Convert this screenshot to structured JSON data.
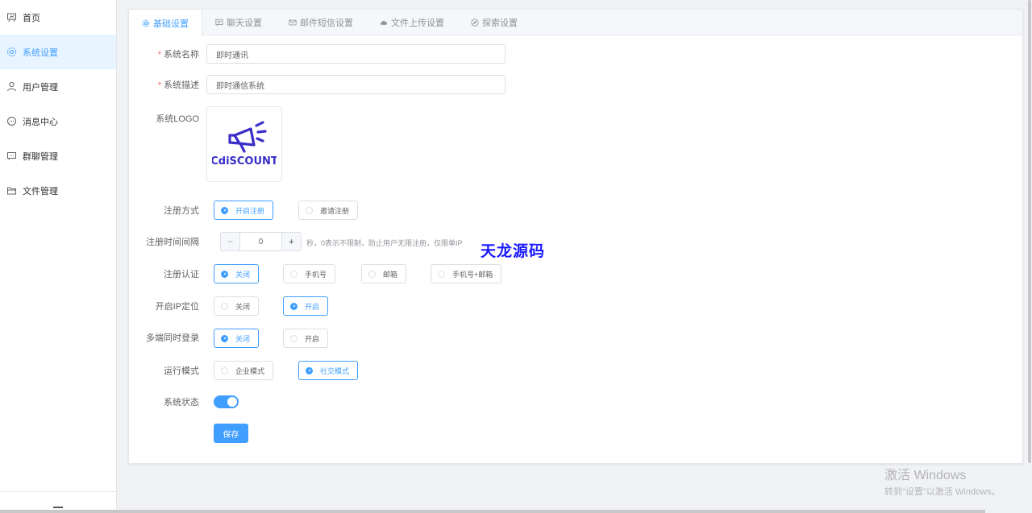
{
  "sidebar": {
    "items": [
      {
        "label": "首页",
        "icon": "home-icon"
      },
      {
        "label": "系统设置",
        "icon": "gear-icon",
        "active": true
      },
      {
        "label": "用户管理",
        "icon": "user-icon"
      },
      {
        "label": "消息中心",
        "icon": "chat-icon"
      },
      {
        "label": "群聊管理",
        "icon": "group-chat-icon"
      },
      {
        "label": "文件管理",
        "icon": "folder-icon"
      }
    ]
  },
  "tabs": [
    {
      "label": "基础设置",
      "icon": "gear-icon",
      "active": true
    },
    {
      "label": "聊天设置",
      "icon": "chat-bubble-icon"
    },
    {
      "label": "邮件短信设置",
      "icon": "mail-icon"
    },
    {
      "label": "文件上传设置",
      "icon": "cloud-upload-icon"
    },
    {
      "label": "探索设置",
      "icon": "compass-icon"
    }
  ],
  "form": {
    "system_name": {
      "label": "系统名称",
      "value": "即时通讯"
    },
    "system_desc": {
      "label": "系统描述",
      "value": "即时通信系统"
    },
    "system_logo": {
      "label": "系统LOGO",
      "logo_text": "CdiSCOUNT"
    },
    "register_mode": {
      "label": "注册方式",
      "options": [
        "开启注册",
        "邀请注册"
      ],
      "selected": 0
    },
    "register_interval": {
      "label": "注册时间间隔",
      "value": "0",
      "hint": "秒，0表示不限制，防止用户无限注册，仅限单IP"
    },
    "register_auth": {
      "label": "注册认证",
      "options": [
        "关闭",
        "手机号",
        "邮箱",
        "手机号+邮箱"
      ],
      "selected": 0
    },
    "ip_location": {
      "label": "开启IP定位",
      "options": [
        "关闭",
        "开启"
      ],
      "selected": 1
    },
    "multi_login": {
      "label": "多端同时登录",
      "options": [
        "关闭",
        "开启"
      ],
      "selected": 0
    },
    "run_mode": {
      "label": "运行模式",
      "options": [
        "企业模式",
        "社交模式"
      ],
      "selected": 1
    },
    "system_status": {
      "label": "系统状态",
      "on": true
    },
    "save_label": "保存"
  },
  "watermark": "天龙源码",
  "windows_activation": {
    "line1": "激活 Windows",
    "line2": "转到\"设置\"以激活 Windows。"
  },
  "colors": {
    "accent": "#409eff",
    "required": "#f56c6c",
    "watermark": "#1a1aff"
  }
}
